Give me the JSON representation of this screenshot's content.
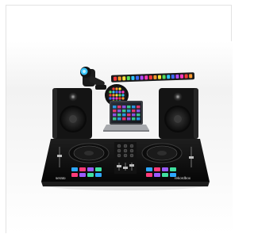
{
  "product_image": {
    "alt": "DJ controller bundle with monitor speakers, laptop, moving head light, LED par and LED bar",
    "controller": {
      "brand_left": "serato",
      "brand_right": "rekordbox"
    },
    "colors": {
      "background": "#ffffff",
      "floor_gradient_top": "#f4f4f4",
      "speaker_body": "#141414",
      "controller_body": "#0b0b0b",
      "led_bar_colors": [
        "#ff3b3b",
        "#ff9a2e",
        "#ffe23b",
        "#58e05a",
        "#2ec7ff",
        "#3b6bff",
        "#b44bff",
        "#ff3bbf"
      ],
      "pad_colors": [
        "#2ea8ff",
        "#ff3b7a",
        "#9b5bff",
        "#40e0a0"
      ]
    }
  }
}
